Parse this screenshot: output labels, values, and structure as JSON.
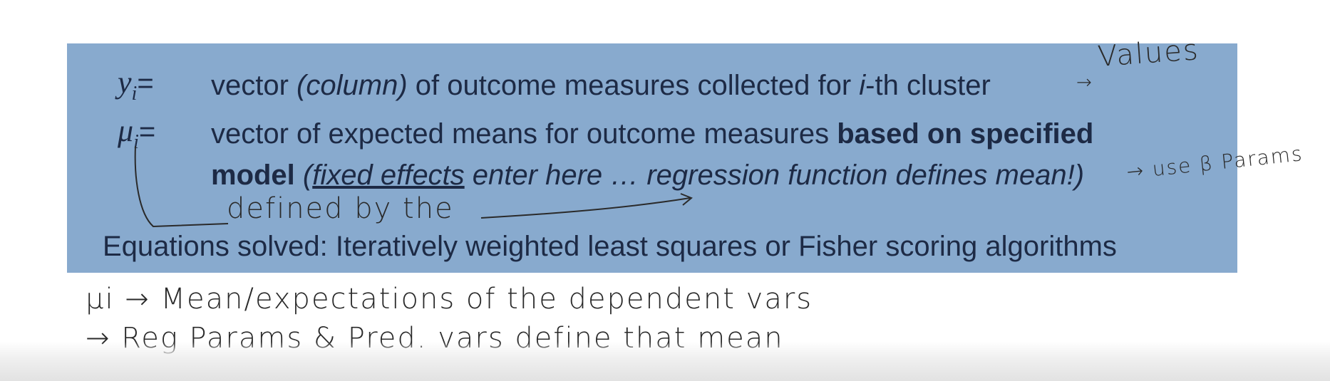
{
  "slide": {
    "row1": {
      "symbol": "y",
      "subscript": "i",
      "equals": "=",
      "text_a": "vector ",
      "text_b": "(column)",
      "text_c": " of outcome measures collected for ",
      "text_d": "i",
      "text_e": "-th cluster"
    },
    "row2": {
      "symbol": "μ",
      "subscript": "i",
      "equals": "=",
      "text_a": "vector of expected means for outcome measures ",
      "text_bold": "based on specified"
    },
    "row3": {
      "bold": "model",
      "text_a": " (",
      "underlined": "fixed effects",
      "text_b": " enter here … regression function defines mean!)"
    },
    "footer": "Equations solved: Iteratively weighted least squares or Fisher scoring algorithms"
  },
  "annotations": {
    "values": "Values",
    "use_params": "→ use β Params",
    "defined_by": "defined by the",
    "arrow_row1": "→",
    "note1": "μi → Mean/expectations of the dependent vars",
    "note2": "→ Reg Params & Pred. vars define that mean"
  }
}
